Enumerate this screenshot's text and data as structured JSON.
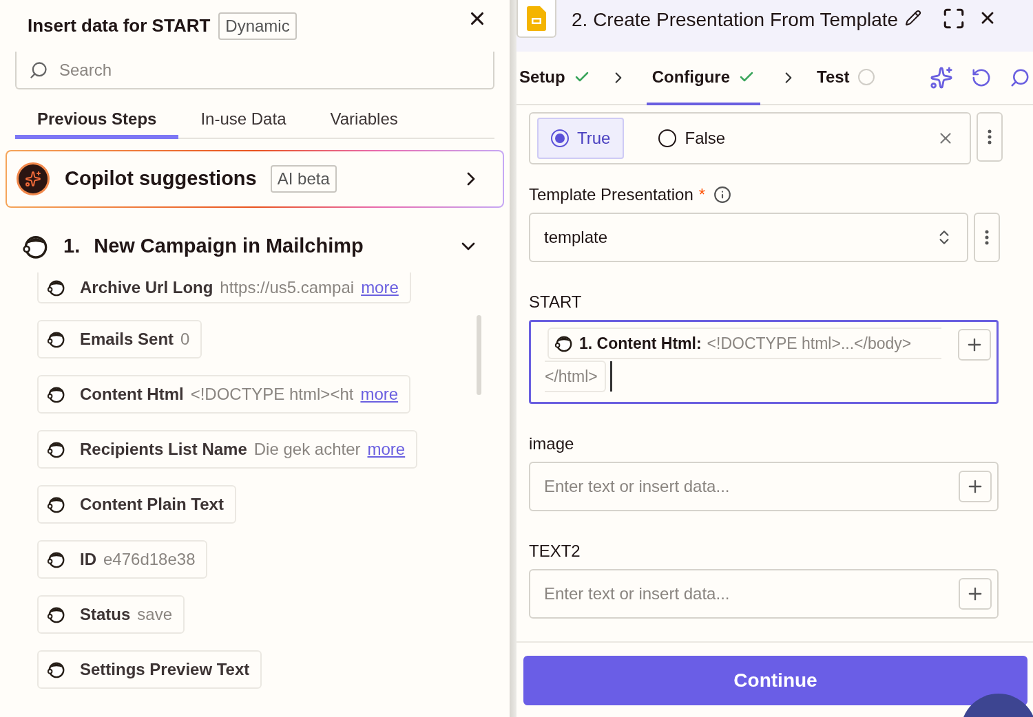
{
  "left": {
    "title": "Insert data for START",
    "badge": "Dynamic",
    "search": {
      "placeholder": "Search"
    },
    "tabs": [
      {
        "label": "Previous Steps",
        "selected": true
      },
      {
        "label": "In-use Data",
        "selected": false
      },
      {
        "label": "Variables",
        "selected": false
      }
    ],
    "copilot": {
      "title": "Copilot suggestions",
      "badge": "AI beta"
    },
    "step": {
      "number": "1.",
      "title": "New Campaign in Mailchimp",
      "expanded": true
    },
    "fields": [
      {
        "label": "Archive Url Long",
        "value": "https://us5.campai",
        "more": "more"
      },
      {
        "label": "Emails Sent",
        "value": "0"
      },
      {
        "label": "Content Html",
        "value": "<!DOCTYPE html><ht",
        "more": "more"
      },
      {
        "label": "Recipients List Name",
        "value": "Die gek achter",
        "more": "more"
      },
      {
        "label": "Content Plain Text"
      },
      {
        "label": "ID",
        "value": "e476d18e38"
      },
      {
        "label": "Status",
        "value": "save"
      },
      {
        "label": "Settings Preview Text"
      }
    ]
  },
  "right": {
    "title": "2. Create Presentation From Template",
    "tabs": [
      {
        "label": "Setup",
        "done": true,
        "selected": false
      },
      {
        "label": "Configure",
        "done": true,
        "selected": true
      },
      {
        "label": "Test",
        "done": false,
        "selected": false
      }
    ],
    "radio": [
      {
        "label": "True",
        "selected": true
      },
      {
        "label": "False",
        "selected": false
      }
    ],
    "fields": [
      {
        "kind": "select",
        "label": "Template Presentation",
        "required_mark": "*",
        "value": "template"
      },
      {
        "kind": "tokens",
        "label": "START",
        "focused": true,
        "token_label": "1. Content Html:",
        "token_value": "<!DOCTYPE html>...</body>",
        "token_rest": "</html>"
      },
      {
        "kind": "text",
        "label": "image",
        "placeholder": "Enter text or insert data..."
      },
      {
        "kind": "text",
        "label": "TEXT2",
        "placeholder": "Enter text or insert data..."
      }
    ],
    "continue": "Continue"
  }
}
